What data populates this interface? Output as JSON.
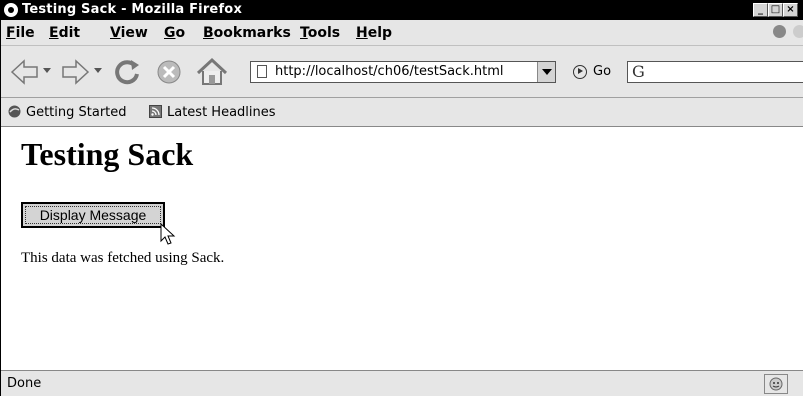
{
  "window": {
    "title": "Testing Sack - Mozilla Firefox"
  },
  "menu": [
    {
      "first": "F",
      "rest": "ile"
    },
    {
      "first": "E",
      "rest": "dit"
    },
    {
      "first": "V",
      "rest": "iew"
    },
    {
      "first": "G",
      "rest": "o"
    },
    {
      "first": "B",
      "rest": "ookmarks"
    },
    {
      "first": "T",
      "rest": "ools"
    },
    {
      "first": "H",
      "rest": "elp"
    }
  ],
  "navbar": {
    "url": "http://localhost/ch06/testSack.html",
    "go_label": "Go"
  },
  "bookmarks": {
    "getting_started": "Getting Started",
    "latest_headlines": "Latest Headlines"
  },
  "page": {
    "heading": "Testing Sack",
    "button_label": "Display Message",
    "result_text": "This data was fetched using Sack."
  },
  "status": {
    "text": "Done"
  },
  "icons": [
    "firefox-icon",
    "back-icon",
    "forward-icon",
    "reload-icon",
    "stop-icon",
    "home-icon",
    "page-icon",
    "go-icon",
    "google-search-icon",
    "getting-started-icon",
    "rss-feed-icon",
    "mouse-cursor-icon",
    "security-icon"
  ]
}
